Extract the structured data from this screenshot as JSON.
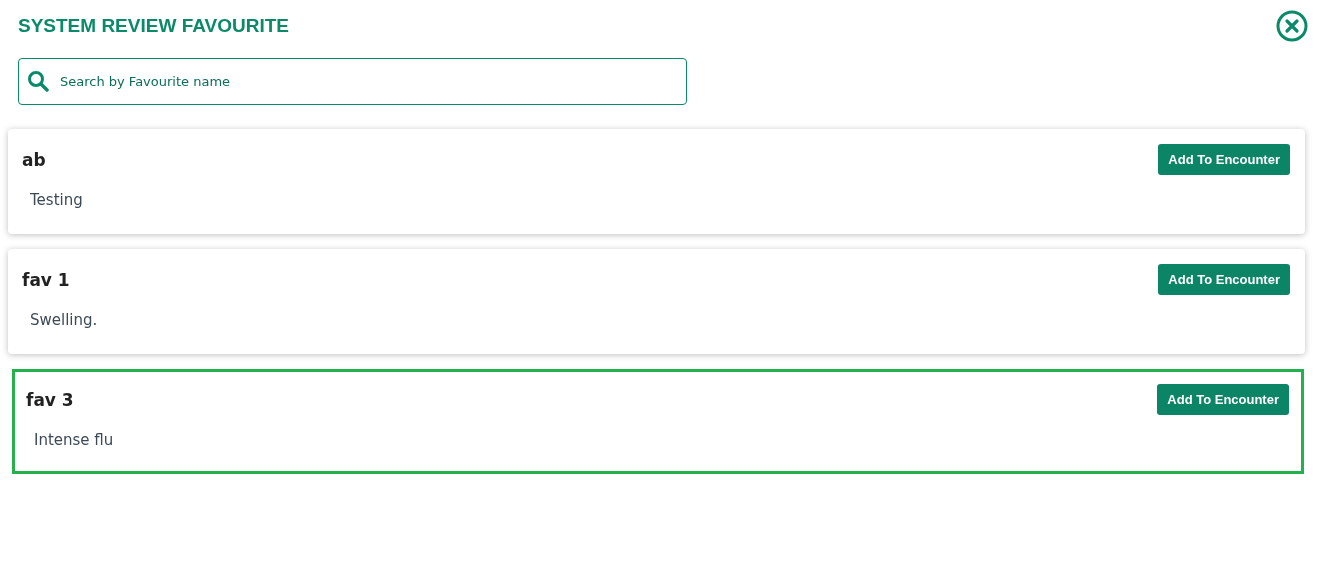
{
  "title": "SYSTEM REVIEW FAVOURITE",
  "search": {
    "placeholder": "Search by Favourite name"
  },
  "favourites": [
    {
      "name": "ab",
      "description": "Testing",
      "button": "Add To Encounter",
      "selected": false
    },
    {
      "name": "fav 1",
      "description": "Swelling.",
      "button": "Add To Encounter",
      "selected": false
    },
    {
      "name": "fav 3",
      "description": "Intense flu",
      "button": "Add To Encounter",
      "selected": true
    }
  ]
}
